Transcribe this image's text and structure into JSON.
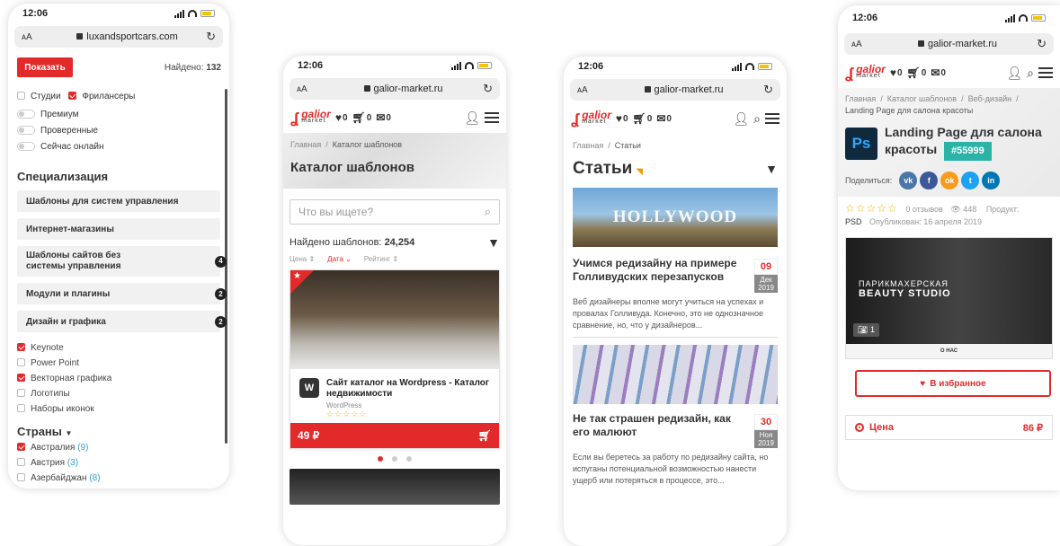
{
  "time": "12:06",
  "phone1": {
    "url": "luxandsportcars.com",
    "show_button": "Показать",
    "found_label": "Найдено:",
    "found_count": "132",
    "checks": [
      {
        "label": "Студии",
        "on": false
      },
      {
        "label": "Фрилансеры",
        "on": true
      }
    ],
    "toggles": [
      "Премиум",
      "Проверенные",
      "Сейчас онлайн"
    ],
    "spec_title": "Специализация",
    "spec_items": [
      {
        "label": "Шаблоны для систем управления",
        "badge": ""
      },
      {
        "label": "Интернет-магазины",
        "badge": ""
      },
      {
        "label": "Шаблоны сайтов без системы управления",
        "badge": "4"
      },
      {
        "label": "Модули и плагины",
        "badge": "2"
      },
      {
        "label": "Дизайн и графика",
        "badge": "2"
      }
    ],
    "sub_checks": [
      {
        "label": "Keynote",
        "on": true
      },
      {
        "label": "Power Point",
        "on": false
      },
      {
        "label": "Векторная графика",
        "on": true
      },
      {
        "label": "Логотипы",
        "on": false
      },
      {
        "label": "Наборы иконок",
        "on": false
      }
    ],
    "countries_title": "Страны",
    "countries": [
      {
        "label": "Австралия",
        "count": "(9)",
        "on": true
      },
      {
        "label": "Австрия",
        "count": "(3)",
        "on": false
      },
      {
        "label": "Азербайджан",
        "count": "(8)",
        "on": false
      }
    ]
  },
  "header": {
    "wish": "0",
    "cart": "0",
    "mail": "0",
    "logo_top": "galior",
    "logo_bottom": "market"
  },
  "phone2": {
    "url": "galior-market.ru",
    "crumb1": "Главная",
    "crumb2": "Каталог шаблонов",
    "title": "Каталог шаблонов",
    "search_placeholder": "Что вы ищете?",
    "found_label": "Найдено шаблонов:",
    "found_count": "24,254",
    "sort": [
      "Цена",
      "Дата",
      "Рейтинг"
    ],
    "card_title": "Сайт каталог на Wordpress - Каталог недвижимости",
    "card_cat": "WordPress",
    "price": "49 ₽"
  },
  "phone3": {
    "url": "galior-market.ru",
    "crumb1": "Главная",
    "crumb2": "Статьи",
    "title": "Статьи",
    "articles": [
      {
        "img": "HOLLYWOOD",
        "title": "Учимся редизайну на примере Голливудских перезапусков",
        "day": "09",
        "month": "Дек",
        "year": "2019",
        "text": "Веб дизайнеры вполне могут учиться на успехах и провалах Голливуда. Конечно, это не однозначное сравнение, но, что у дизайнеров..."
      },
      {
        "img": "",
        "title": "Не так страшен редизайн, как его малюют",
        "day": "30",
        "month": "Ноя",
        "year": "2019",
        "text": "Если вы беретесь за работу по редизайну сайта, но испуганы потенциальной возможностью нанести ущерб или потеряться в процессе, это..."
      }
    ]
  },
  "phone4": {
    "url": "galior-market.ru",
    "crumbs": [
      "Главная",
      "Каталог шаблонов",
      "Веб-дизайн",
      "Landing Page для салона красоты"
    ],
    "ps": "Ps",
    "title": "Landing Page для салона красоты",
    "id": "#55999",
    "share_label": "Поделиться:",
    "reviews": "0 отзывов",
    "views": "448",
    "product_label": "Продукт:",
    "product": "PSD",
    "published": "Опубликован: 16 апреля 2019",
    "preview_line1": "ПАРИКМАХЕРСКАЯ",
    "preview_line2": "BEAUTY STUDIO",
    "preview_about": "О НАС",
    "shots": "1",
    "fav": "В избранное",
    "price_label": "Цена",
    "price": "86 ₽"
  }
}
